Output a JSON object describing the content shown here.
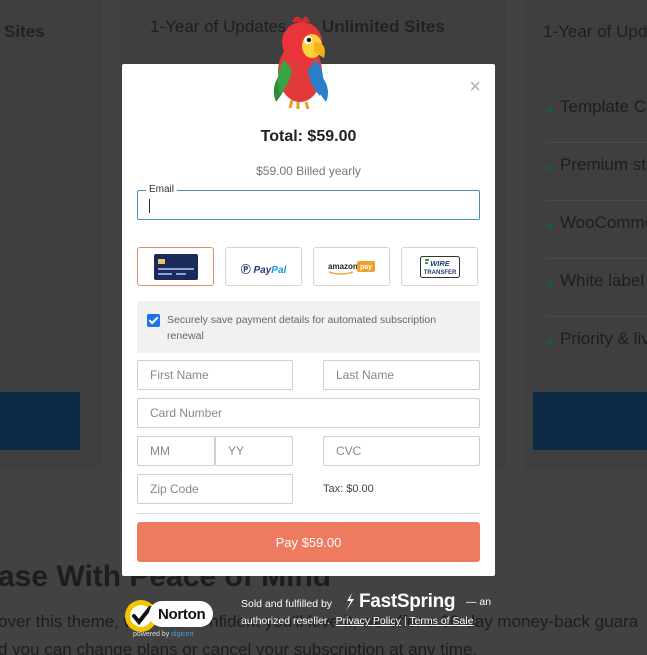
{
  "background": {
    "heading_left": "Sites",
    "heading_mid_1": "1-Year of Updates",
    "heading_mid_2": "Unlimited Sites",
    "heading_right": "1-Year of Upd",
    "features": [
      "Template C",
      "Premium st",
      "WooComme",
      "White label",
      "Priority & liv"
    ],
    "tagline": "ase With Peace of Mind",
    "line1": "over this theme, we're so confident you'll love it, we offer a 30-day money-back guara",
    "line2": "d you can change plans or cancel your subscription at any time."
  },
  "modal": {
    "close_icon": "×",
    "total": "Total: $59.00",
    "billed": "$59.00 Billed yearly",
    "email_label": "Email",
    "payment_methods": [
      "card",
      "PayPal",
      "amazon pay",
      "WIRE TRANSFER"
    ],
    "paypal_pay": "Pay",
    "paypal_pal": "Pal",
    "amazon_text": "amazon",
    "amazon_pay": "pay",
    "wire_text_1": "WIRE",
    "wire_text_2": "TRANSFER",
    "save_text": "Securely save payment details for automated subscription renewal",
    "placeholders": {
      "first_name": "First Name",
      "last_name": "Last Name",
      "card_number": "Card Number",
      "mm": "MM",
      "yy": "YY",
      "cvc": "CVC",
      "zip": "Zip Code"
    },
    "tax": "Tax: $0.00",
    "pay_button": "Pay $59.00",
    "colors": {
      "accent": "#ee7a60",
      "focus": "#4a8fc0",
      "checkbox": "#1a73e8"
    }
  },
  "footer": {
    "norton_name": "Norton",
    "norton_powered": "powered by",
    "norton_digicert": "digicert",
    "sold_by": "Sold and fulfilled by",
    "fastspring": "FastSpring",
    "dash": "— an",
    "reseller": "authorized reseller.",
    "privacy": "Privacy Policy",
    "sep": "|",
    "terms": "Terms of Sale"
  }
}
